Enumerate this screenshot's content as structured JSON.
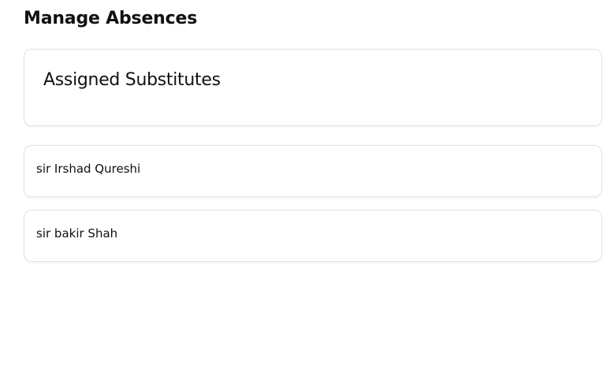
{
  "page": {
    "title": "Manage Absences"
  },
  "assigned_substitutes": {
    "title": "Assigned Substitutes",
    "items": [
      {
        "name": "sir Irshad Qureshi"
      },
      {
        "name": "sir bakir Shah"
      }
    ]
  }
}
